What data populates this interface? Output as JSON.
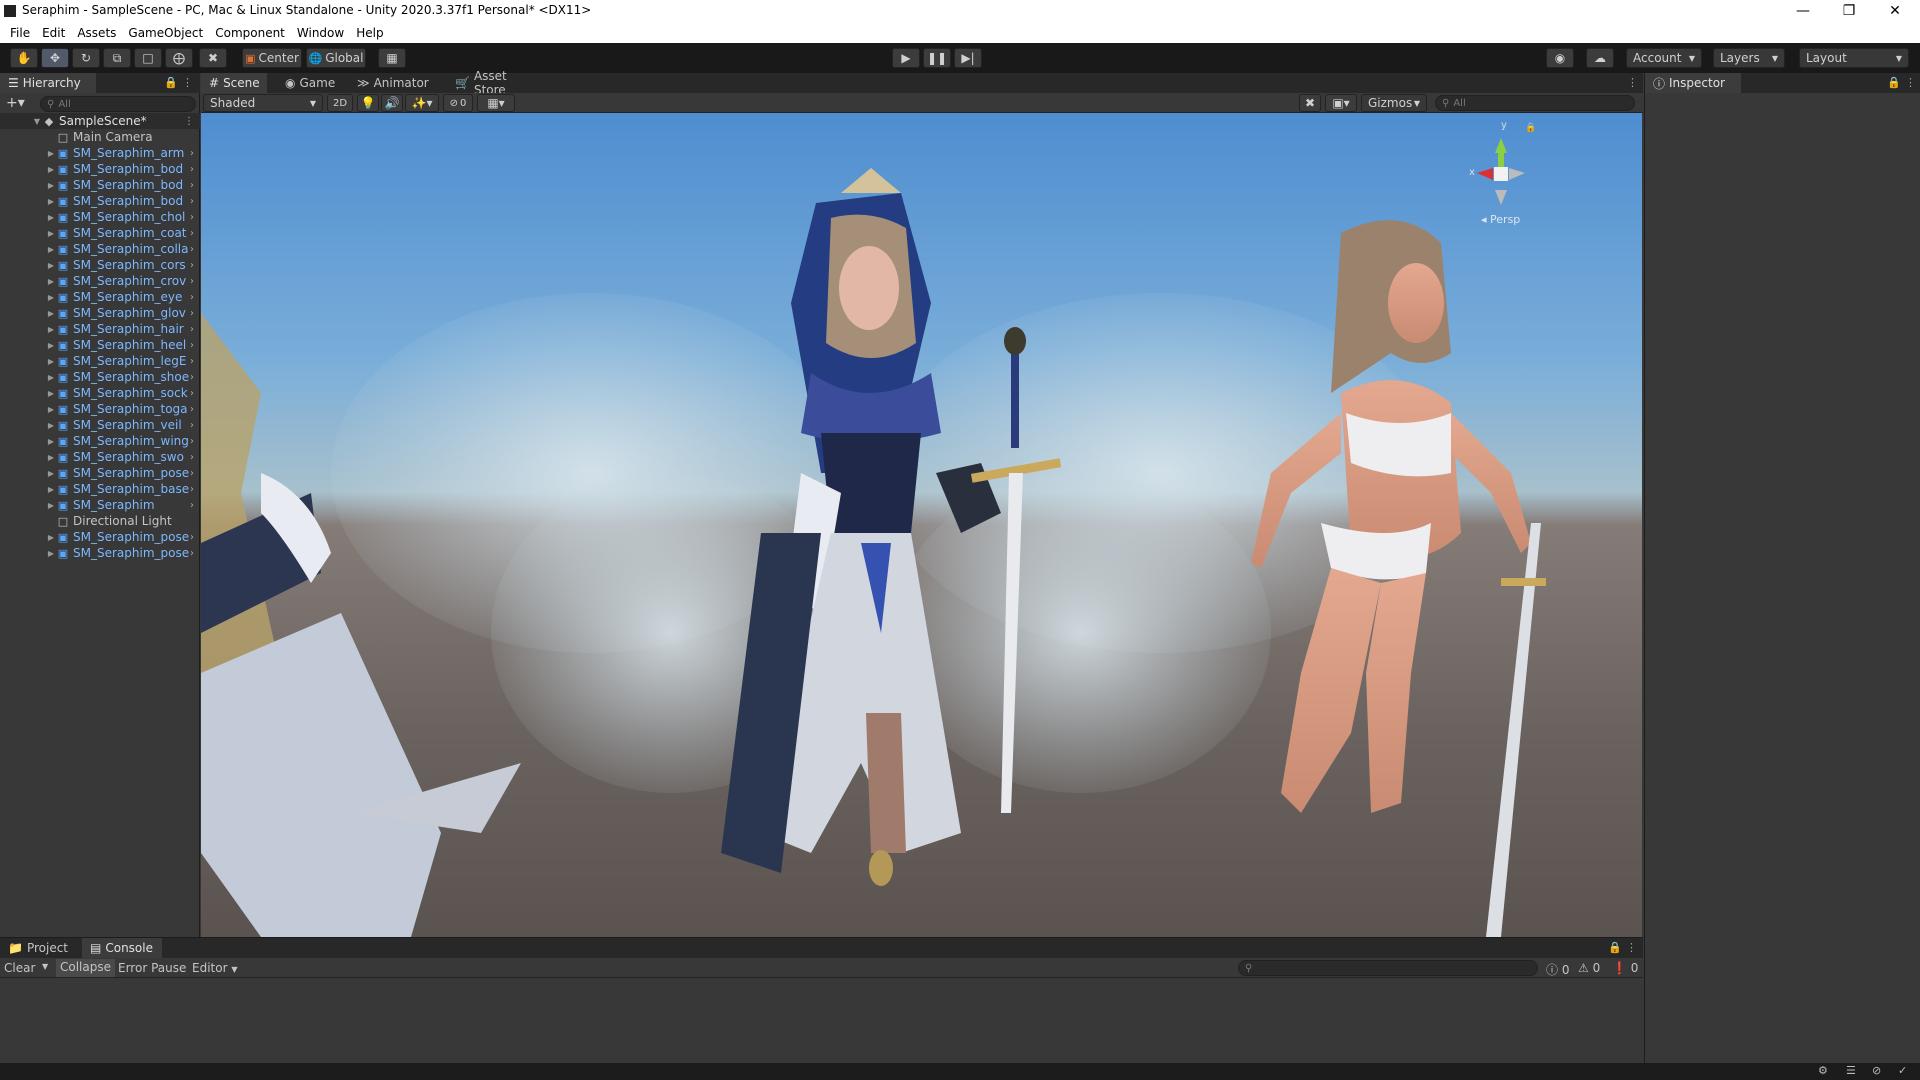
{
  "window": {
    "title": "Seraphim - SampleScene - PC, Mac & Linux Standalone - Unity 2020.3.37f1 Personal* <DX11>"
  },
  "menu": [
    "File",
    "Edit",
    "Assets",
    "GameObject",
    "Component",
    "Window",
    "Help"
  ],
  "toolbar": {
    "pivot": "Center",
    "space": "Global",
    "account": "Account",
    "layers": "Layers",
    "layout": "Layout"
  },
  "hierarchy": {
    "tab": "Hierarchy",
    "search_placeholder": "All",
    "scene": "SampleScene*",
    "items": [
      {
        "label": "Main Camera",
        "prefab": false
      },
      {
        "label": "SM_Seraphim_arm",
        "prefab": true
      },
      {
        "label": "SM_Seraphim_bod",
        "prefab": true
      },
      {
        "label": "SM_Seraphim_bod",
        "prefab": true
      },
      {
        "label": "SM_Seraphim_bod",
        "prefab": true
      },
      {
        "label": "SM_Seraphim_chol",
        "prefab": true
      },
      {
        "label": "SM_Seraphim_coat",
        "prefab": true
      },
      {
        "label": "SM_Seraphim_colla",
        "prefab": true
      },
      {
        "label": "SM_Seraphim_cors",
        "prefab": true
      },
      {
        "label": "SM_Seraphim_crov",
        "prefab": true
      },
      {
        "label": "SM_Seraphim_eye",
        "prefab": true
      },
      {
        "label": "SM_Seraphim_glov",
        "prefab": true
      },
      {
        "label": "SM_Seraphim_hair",
        "prefab": true
      },
      {
        "label": "SM_Seraphim_heel",
        "prefab": true
      },
      {
        "label": "SM_Seraphim_legE",
        "prefab": true
      },
      {
        "label": "SM_Seraphim_shoe",
        "prefab": true
      },
      {
        "label": "SM_Seraphim_sock",
        "prefab": true
      },
      {
        "label": "SM_Seraphim_toga",
        "prefab": true
      },
      {
        "label": "SM_Seraphim_veil",
        "prefab": true
      },
      {
        "label": "SM_Seraphim_wing",
        "prefab": true
      },
      {
        "label": "SM_Seraphim_swo",
        "prefab": true
      },
      {
        "label": "SM_Seraphim_pose",
        "prefab": true
      },
      {
        "label": "SM_Seraphim_base",
        "prefab": true
      },
      {
        "label": "SM_Seraphim",
        "prefab": true
      },
      {
        "label": "Directional Light",
        "prefab": false
      },
      {
        "label": "SM_Seraphim_pose",
        "prefab": true
      },
      {
        "label": "SM_Seraphim_pose",
        "prefab": true
      }
    ]
  },
  "scene_tabs": [
    "Scene",
    "Game",
    "Animator",
    "Asset Store"
  ],
  "scene_toolbar": {
    "shading": "Shaded",
    "mode_2d": "2D",
    "hidden_count": "0",
    "gizmos": "Gizmos",
    "search_placeholder": "All"
  },
  "gizmo": {
    "persp": "Persp",
    "y": "y",
    "x": "x"
  },
  "inspector": {
    "tab": "Inspector"
  },
  "console": {
    "tabs": [
      "Project",
      "Console"
    ],
    "clear": "Clear",
    "collapse": "Collapse",
    "error_pause": "Error Pause",
    "editor": "Editor",
    "log_count": "0",
    "warn_count": "0",
    "error_count": "0"
  },
  "colors": {
    "accent": "#4c7fc0",
    "prefab_text": "#7cb7ff",
    "background": "#383838"
  }
}
